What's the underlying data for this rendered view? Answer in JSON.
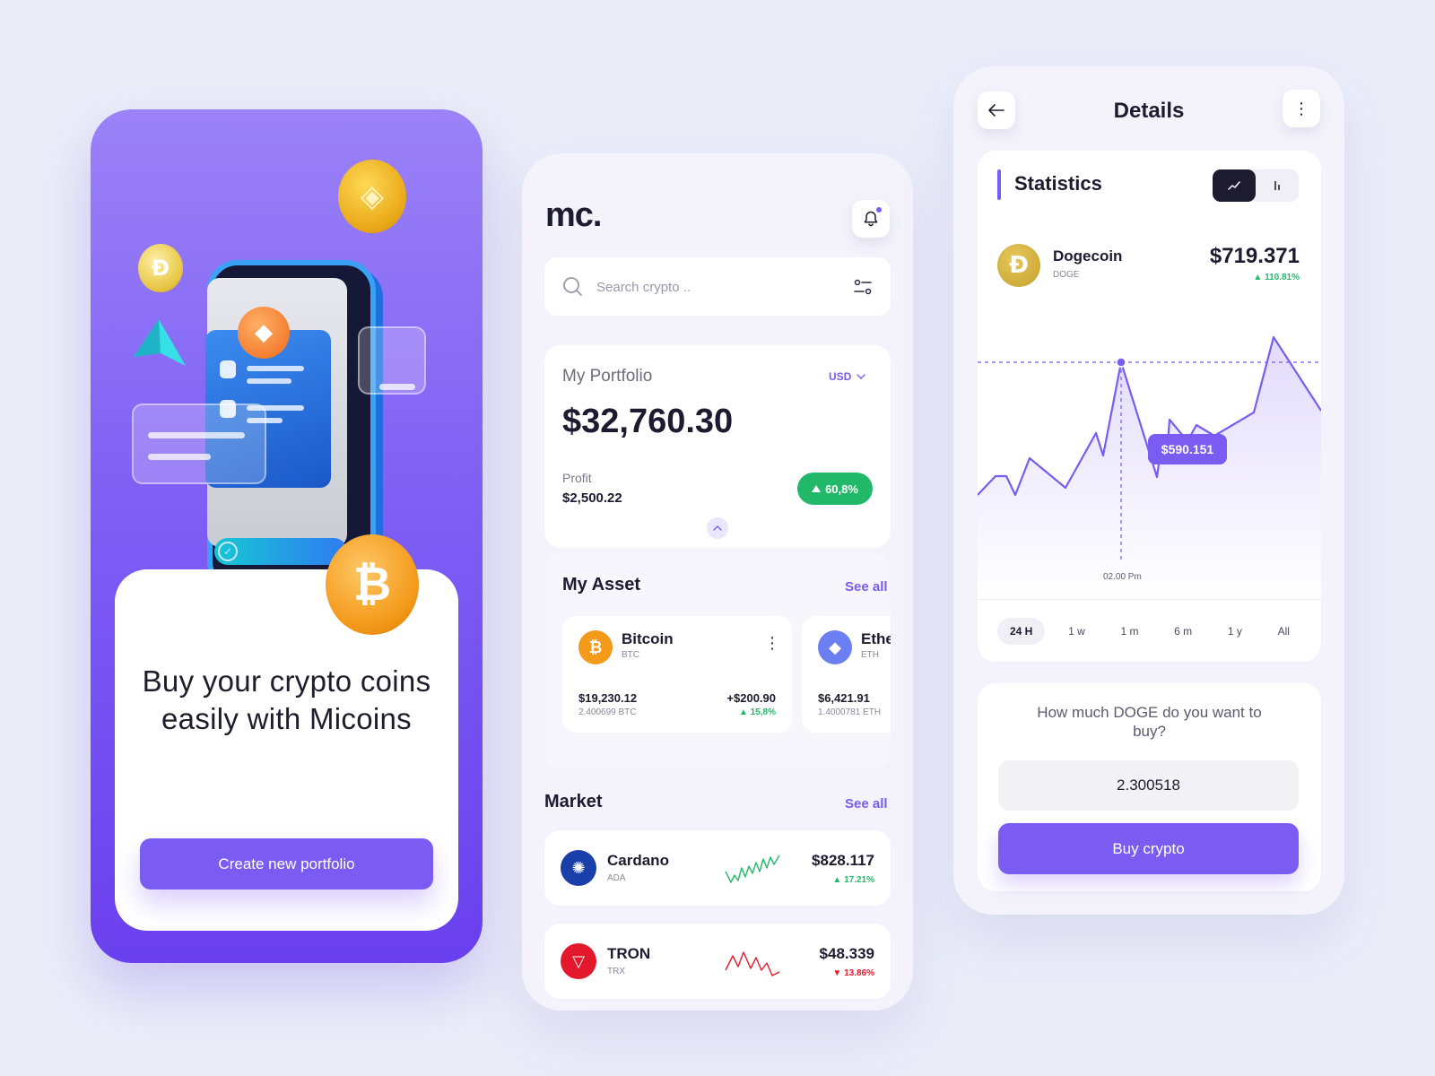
{
  "colors": {
    "accent": "#7a5cf2",
    "positive": "#22b86a",
    "negative": "#e4182c",
    "dark": "#1d1b2f",
    "bitcoin": "#f39a1a",
    "ethereum": "#6b7ef2",
    "cardano": "#1a3fa8",
    "tron": "#e4182c",
    "dogecoin": "#c4a02c"
  },
  "onboarding": {
    "heading": "Buy your crypto coins easily with Micoins",
    "cta_label": "Create new portfolio",
    "illustration_icons": [
      "bnb-coin-icon",
      "dogecoin-icon",
      "arrow-icon",
      "ethereum-icon",
      "bitcoin-icon",
      "phone-receipt-illustration"
    ]
  },
  "home": {
    "logo": "mc.",
    "search": {
      "placeholder": "Search crypto .."
    },
    "portfolio": {
      "title": "My Portfolio",
      "currency": "USD",
      "amount": "$32,760.30",
      "profit_label": "Profit",
      "profit_value": "$2,500.22",
      "profit_pct": "60,8%"
    },
    "assets": {
      "title": "My Asset",
      "see_all": "See all",
      "items": [
        {
          "name": "Bitcoin",
          "symbol": "BTC",
          "icon": "bitcoin-icon",
          "price": "$19,230.12",
          "holding": "2.400699 BTC",
          "gain": "+$200.90",
          "pct": "15,8%"
        },
        {
          "name": "Ethereum",
          "symbol": "ETH",
          "icon": "ethereum-icon",
          "price": "$6,421.91",
          "holding": "1.4000781 ETH",
          "gain": "",
          "pct": ""
        }
      ]
    },
    "market": {
      "title": "Market",
      "see_all": "See all",
      "items": [
        {
          "name": "Cardano",
          "symbol": "ADA",
          "icon": "cardano-icon",
          "price": "$828.117",
          "pct": "17.21%",
          "trend": "up"
        },
        {
          "name": "TRON",
          "symbol": "TRX",
          "icon": "tron-icon",
          "price": "$48.339",
          "pct": "13.86%",
          "trend": "down"
        }
      ]
    }
  },
  "details": {
    "title": "Details",
    "stats_title": "Statistics",
    "chart_modes": [
      "line-chart-icon",
      "bar-chart-icon"
    ],
    "coin": {
      "name": "Dogecoin",
      "symbol": "DOGE",
      "price": "$719.371",
      "pct": "110.81%"
    },
    "tooltip_value": "$590.151",
    "time_label": "02.00 Pm",
    "ranges": [
      "24 H",
      "1 w",
      "1 m",
      "6 m",
      "1 y",
      "All"
    ],
    "active_range": "24 H",
    "buy_question": "How much DOGE do you want to buy?",
    "buy_amount": "2.300518",
    "buy_label": "Buy crypto"
  }
}
